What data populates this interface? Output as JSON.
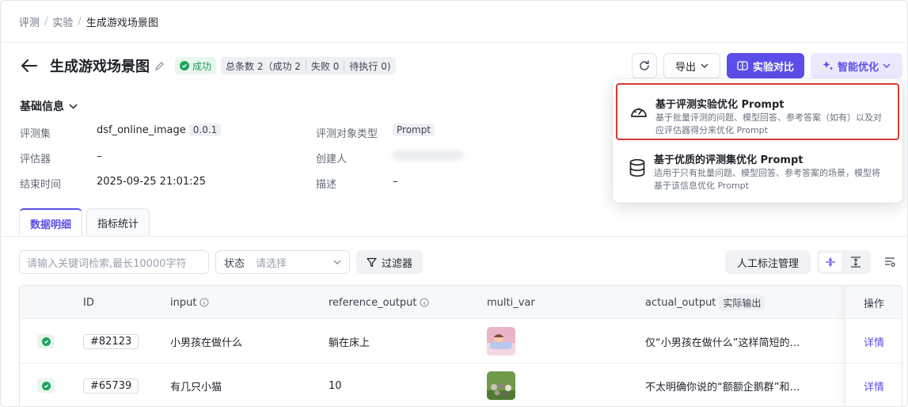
{
  "breadcrumb": {
    "items": [
      "评测",
      "实验",
      "生成游戏场景图"
    ]
  },
  "header": {
    "title": "生成游戏场景图",
    "status": "成功",
    "counts": {
      "total": "总条数 2（成功 2",
      "failed": "失败 0",
      "pending": "待执行 0)"
    },
    "actions": {
      "export": "导出",
      "compare": "实验对比",
      "optimize": "智能优化"
    }
  },
  "basic_info": {
    "title": "基础信息",
    "fields": {
      "dataset_label": "评测集",
      "dataset_value": "dsf_online_image",
      "dataset_version": "0.0.1",
      "evaluator_label": "评估器",
      "evaluator_value": "–",
      "end_time_label": "结束时间",
      "end_time_value": "2025-09-25 21:01:25",
      "target_type_label": "评测对象类型",
      "target_type_value": "Prompt",
      "creator_label": "创建人",
      "desc_label": "描述",
      "desc_value": "–"
    }
  },
  "tabs": [
    "数据明细",
    "指标统计"
  ],
  "toolbar": {
    "search_placeholder": "请输入关键词检索,最长10000字符",
    "status_label": "状态",
    "status_placeholder": "请选择",
    "filter": "过滤器",
    "annotation": "人工标注管理"
  },
  "table": {
    "columns": [
      "ID",
      "input",
      "reference_output",
      "multi_var",
      "actual_output",
      "实际输出",
      "操作"
    ],
    "rows": [
      {
        "id": "#82123",
        "input": "小男孩在做什么",
        "reference": "躺在床上",
        "output": "仅“小男孩在做什么”这样简短的…",
        "action": "详情"
      },
      {
        "id": "#65739",
        "input": "有几只小猫",
        "reference": "10",
        "output": "不太明确你说的“额额企鹅群”和…",
        "action": "详情"
      }
    ]
  },
  "dropdown": {
    "items": [
      {
        "title": "基于评测实验优化 Prompt",
        "desc": "基于批量评测的问题、模型回答、参考答案（如有）以及对应评估器得分来优化 Prompt"
      },
      {
        "title": "基于优质的评测集优化 Prompt",
        "desc": "适用于只有批量问题、模型回答、参考答案的场景，模型将基于该信息优化 Prompt"
      }
    ]
  },
  "colors": {
    "accent": "#5b4ee8",
    "success": "#20a25a",
    "highlight": "#d83a33"
  }
}
